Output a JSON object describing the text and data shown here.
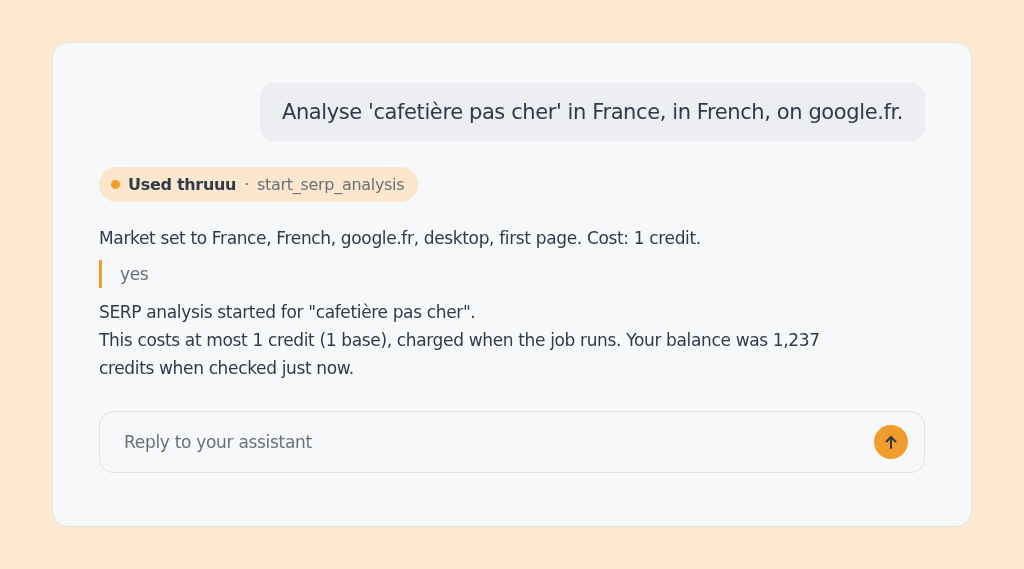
{
  "user_message": "Analyse 'cafetière pas cher' in France, in French, on google.fr.",
  "tool_use": {
    "label": "Used thruuu",
    "separator": "·",
    "tool": "start_serp_analysis",
    "color": "#f29c2b"
  },
  "reply": [
    {
      "kind": "text",
      "text": "Market set to France, French, google.fr, desktop, first page. Cost: 1 credit."
    },
    {
      "kind": "quote",
      "text": "yes"
    },
    {
      "kind": "text",
      "text": "SERP analysis started for \"cafetière pas cher\"."
    },
    {
      "kind": "text",
      "text": "This costs at most 1 credit (1 base), charged when the job runs. Your balance was 1,237 credits when checked just now."
    }
  ],
  "composer": {
    "placeholder": "Reply to your assistant"
  }
}
